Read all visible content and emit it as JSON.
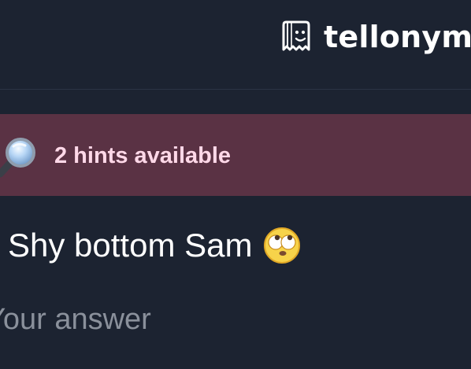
{
  "header": {
    "brand_name": "tellonym",
    "logo_icon": "tellonym-logo-icon"
  },
  "hint": {
    "icon": "magnifying-glass-icon",
    "text": "2 hints available"
  },
  "question": {
    "text": "Shy bottom Sam",
    "emoji": "rolling-eyes-emoji-icon"
  },
  "answer": {
    "placeholder": "Your answer",
    "value": ""
  },
  "colors": {
    "background": "#1c2331",
    "hint_background": "#5a3244",
    "hint_text": "#ffd8e8",
    "text": "#ffffff",
    "placeholder": "#8a909b"
  }
}
